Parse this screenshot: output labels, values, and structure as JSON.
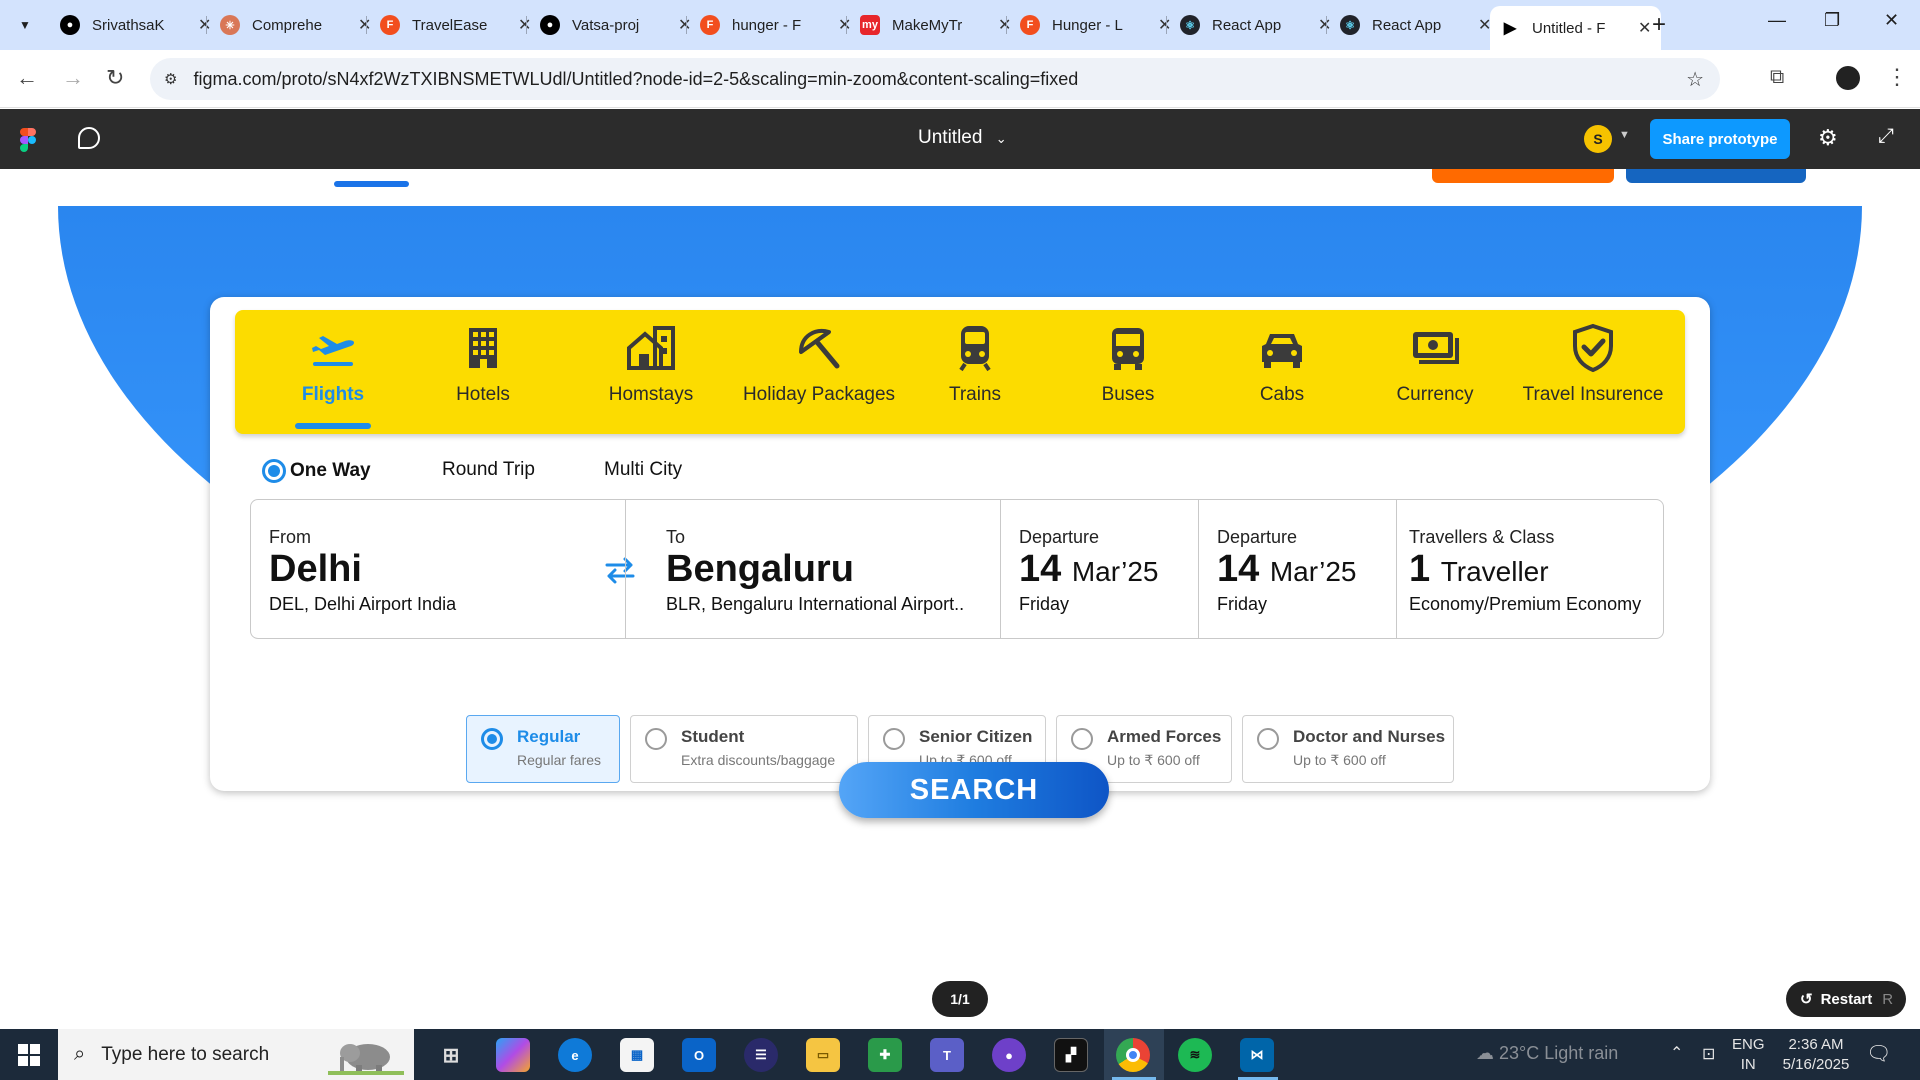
{
  "browser": {
    "tabs": [
      {
        "title": "SrivathsaK",
        "icon": "github-icon",
        "color": "#000000"
      },
      {
        "title": "Comprehe",
        "icon": "claude-icon",
        "color": "#d97757"
      },
      {
        "title": "TravelEase",
        "icon": "figma-icon",
        "color": "#f24e1e"
      },
      {
        "title": "Vatsa-proj",
        "icon": "github-icon",
        "color": "#000000"
      },
      {
        "title": "hunger - F",
        "icon": "figma-icon",
        "color": "#f24e1e"
      },
      {
        "title": "MakeMyTr",
        "icon": "makemytrip-icon",
        "color": "#e7262b"
      },
      {
        "title": "Hunger - L",
        "icon": "figma-icon",
        "color": "#f24e1e"
      },
      {
        "title": "React App",
        "icon": "react-icon",
        "color": "#20232a"
      },
      {
        "title": "React App",
        "icon": "react-icon",
        "color": "#20232a"
      },
      {
        "title": "Untitled - F",
        "icon": "play-icon",
        "color": "#000000",
        "active": true
      }
    ],
    "url": "figma.com/proto/sN4xf2WzTXIBNSMETWLUdl/Untitled?node-id=2-5&scaling=min-zoom&content-scaling=fixed"
  },
  "figma": {
    "file_title": "Untitled",
    "avatar_initial": "S",
    "share_label": "Share prototype"
  },
  "categories": [
    {
      "label": "Flights",
      "icon": "plane-takeoff-icon",
      "active": true
    },
    {
      "label": "Hotels",
      "icon": "building-icon"
    },
    {
      "label": "Homstays",
      "icon": "house-icon"
    },
    {
      "label": "Holiday Packages",
      "icon": "beach-umbrella-icon"
    },
    {
      "label": "Trains",
      "icon": "train-icon"
    },
    {
      "label": "Buses",
      "icon": "bus-icon"
    },
    {
      "label": "Cabs",
      "icon": "car-icon"
    },
    {
      "label": "Currency",
      "icon": "money-icon"
    },
    {
      "label": "Travel Insurence",
      "icon": "shield-check-icon"
    }
  ],
  "trip_types": [
    {
      "label": "One Way",
      "selected": true
    },
    {
      "label": "Round Trip"
    },
    {
      "label": "Multi City"
    }
  ],
  "search": {
    "from": {
      "caption": "From",
      "city": "Delhi",
      "airport": "DEL, Delhi Airport India"
    },
    "to": {
      "caption": "To",
      "city": "Bengaluru",
      "airport": "BLR, Bengaluru International Airport.."
    },
    "departure1": {
      "caption": "Departure",
      "day": "14",
      "month": "Mar’25",
      "weekday": "Friday"
    },
    "departure2": {
      "caption": "Departure",
      "day": "14",
      "month": "Mar’25",
      "weekday": "Friday"
    },
    "travellers": {
      "caption": "Travellers & Class",
      "count": "1",
      "unit": "Traveller",
      "class": "Economy/Premium Economy"
    }
  },
  "fares": [
    {
      "name": "Regular",
      "desc": "Regular fares",
      "selected": true
    },
    {
      "name": "Student",
      "desc": "Extra discounts/baggage"
    },
    {
      "name": "Senior Citizen",
      "desc": "Up to ₹ 600 off"
    },
    {
      "name": "Armed Forces",
      "desc": "Up to ₹ 600 off"
    },
    {
      "name": "Doctor and Nurses",
      "desc": "Up to ₹ 600 off"
    }
  ],
  "search_button": "SEARCH",
  "prototype": {
    "pager": "1/1",
    "restart_label": "Restart",
    "restart_key": "R"
  },
  "taskbar": {
    "search_placeholder": "Type here to search",
    "weather": "23°C  Light rain",
    "lang_top": "ENG",
    "lang_bottom": "IN",
    "time": "2:36 AM",
    "date": "5/16/2025"
  },
  "colors": {
    "accent": "#1e8ce8",
    "category_bar": "#fcdc00",
    "hero_blue": "#2d8cf0",
    "figma_bar": "#2c2c2c",
    "share_button": "#0d99ff"
  }
}
